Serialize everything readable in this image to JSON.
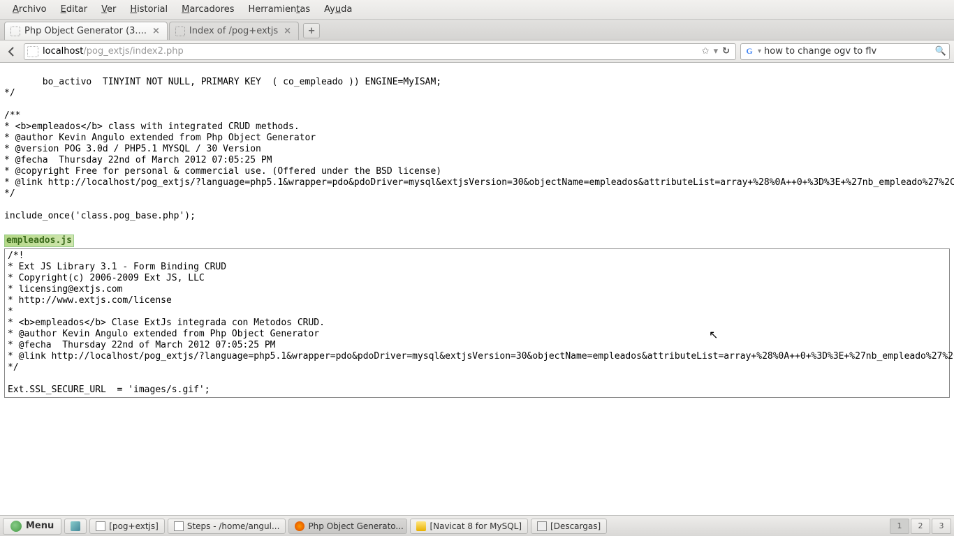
{
  "menubar": {
    "items": [
      {
        "pre": "",
        "u": "A",
        "post": "rchivo"
      },
      {
        "pre": "",
        "u": "E",
        "post": "ditar"
      },
      {
        "pre": "",
        "u": "V",
        "post": "er"
      },
      {
        "pre": "",
        "u": "H",
        "post": "istorial"
      },
      {
        "pre": "",
        "u": "M",
        "post": "arcadores"
      },
      {
        "pre": "Herramien",
        "u": "t",
        "post": "as"
      },
      {
        "pre": "Ay",
        "u": "u",
        "post": "da"
      }
    ]
  },
  "tabs": [
    {
      "title": "Php Object Generator (3....",
      "active": true
    },
    {
      "title": "Index of /pog+extjs",
      "active": false
    }
  ],
  "url": {
    "host": "localhost",
    "path": "/pog_extjs/index2.php"
  },
  "search": {
    "value": "how to change ogv to flv"
  },
  "code": {
    "top": "       bo_activo  TINYINT NOT NULL, PRIMARY KEY  ( co_empleado )) ENGINE=MyISAM;\n*/\n\n/**\n* <b>empleados</b> class with integrated CRUD methods.\n* @author Kevin Angulo extended from Php Object Generator\n* @version POG 3.0d / PHP5.1 MYSQL / 30 Version\n* @fecha  Thursday 22nd of March 2012 07:05:25 PM\n* @copyright Free for personal & commercial use. (Offered under the BSD license)\n* @link http://localhost/pog_extjs/?language=php5.1&wrapper=pdo&pdoDriver=mysql&extjsVersion=30&objectName=empleados&attributeList=array+%28%0A++0+%3D%3E+%27nb_empleado%27%2C%0A++1+%27%2C%0A++2+%3D%3E+%27tx_email%27%2C%0A++3+%3D%3E+%27tx_direccion%27%2C%0A++4+%3D%3E+%27fe_ingreso%27%2C%0A++5+%3D%3E+%27mo_sueldo%27%2C%0A++6+%3D%3E+%27bo_activo%27%2C%0A+%29&typeL%2B%2528%250A%2B%2B0%2B%253D%253E%2B%2527VARCHAR%2528255%2529%2527%252C%250A%2B%2B1%2B%253D%253E%2B%2527VARCHAR%2528255%2529%2527%252C%250A%2B%2B%2B%253D%253E%2B%2527VARCHAR%2528255%2529%2527%252C%250A%2B%2B3%2B%253D%253E%2B%2527VARCHAR%2528255%2529%2527%252C%250A%2B%2B4%2B%253D%253E%2B%2527DATE%2527%252C%250A%2B%2B5%2B%253D%253E%2B%2527FLOAT%2527%252C%250A%2B%2B6%2B%253D%253E%2B%2527TINYINT%2527%252C%250A%2529&renderList=array+%28%0A++0+%3D%3E+%27Ext.form.TextField%27%2C%0A++1+%3D%3E+%27Ext.form.ComboBox%2%3D%3E+%27Ext.form.TextField%27%2C%0A++3+%3D%3E+%27Ext.form.TextArea%27%2C%0A++4+%3D%3E+%27Ext.form.DateField%27%2C%0A++5+%3D%3E+%27Ext.form.TextField%27%2C%0A++6+%3D%3E+%27Ext.form%0A%29\n*/\n\ninclude_once('class.pog_base.php');",
    "filename": "empleados.js",
    "bottom": "/*!\n* Ext JS Library 3.1 - Form Binding CRUD\n* Copyright(c) 2006-2009 Ext JS, LLC\n* licensing@extjs.com\n* http://www.extjs.com/license\n*\n* <b>empleados</b> Clase ExtJs integrada con Metodos CRUD.\n* @author Kevin Angulo extended from Php Object Generator\n* @fecha  Thursday 22nd of March 2012 07:05:25 PM\n* @link http://localhost/pog_extjs/?language=php5.1&wrapper=pdo&pdoDriver=mysql&extjsVersion=30&objectName=empleados&attributeList=array+%28%0A++0+%3D%3E+%27nb_empleado%27%2C%0A++1+%27%2C%0A++2+%3D%3E+%27tx_email%27%2C%0A++3+%3D%3E+%27tx_direccion%27%2C%0A++4+%3D%3E+%27fe_ingreso%27%2C%0A++5+%3D%3E+%27mo_sueldo%27%2C%0A++6+%3D%3E+%27bo_activo%27%2C%0A+%29&typeL%2B%2528%250A%2B%2B0%2B%253D%253E%2B%2527VARCHAR%2528255%2529%2527%252C%250A%2B%2B1%2B%253D%253E%2B%2527VARCHAR%2528255%2529%2527%252C%250A%2B%2B2%2B%253D%253E%2B%2527VARCHAR%2528255%2529%2527%252C%250A%2B%2B3%2B%253D%253E%2B%2527VARCHAR%2528255%2529%2527%252C%250A%2B%2B4%2B%253D%253E%2B%2527DATE%2527%252C%250A%2B%2B5%2B%253D%253E%2B%2527FLOAT%2527%252C%250A%2B%2B6%2B%253D%253E%2B%2527TINYINT%2527%252C%250A%2529&renderList=array%2B%2528%250A%2B%2B0%2B%253D%253E%2B%2527Ext.form.TextField%2527%252C%250A%2B%2B1%2B%2527Ext.form.ComboBox%2527%252C%250A%2B%2B2%2B%253D%253E%2B%2527Ext.form.TextField%2527%252C%250A%2B%2B3%2B%253D%253E%2B%2527Ext.form.TextArea%2527%252C%250A%2B%2B4%2B%253D%253E%2B%2527Ext.form.DateField%2527%252C%250A%2B%2B5%2B%253D%253E%2B%2527Ext.form.TextField%2527%252C%250A%2B%2B6%2B%253D%253E%2B%2527Ext.form.Checkbox%2527%252C%250A%2529\n*/\n\nExt.SSL_SECURE_URL  = 'images/s.gif';"
  },
  "taskbar": {
    "menu": "Menu",
    "items": [
      {
        "label": "[pog+extjs]"
      },
      {
        "label": "Steps - /home/angul..."
      },
      {
        "label": "Php Object Generato...",
        "active": true
      },
      {
        "label": "[Navicat 8 for MySQL]"
      },
      {
        "label": "[Descargas]"
      }
    ],
    "workspaces": [
      "1",
      "2",
      "3"
    ]
  }
}
